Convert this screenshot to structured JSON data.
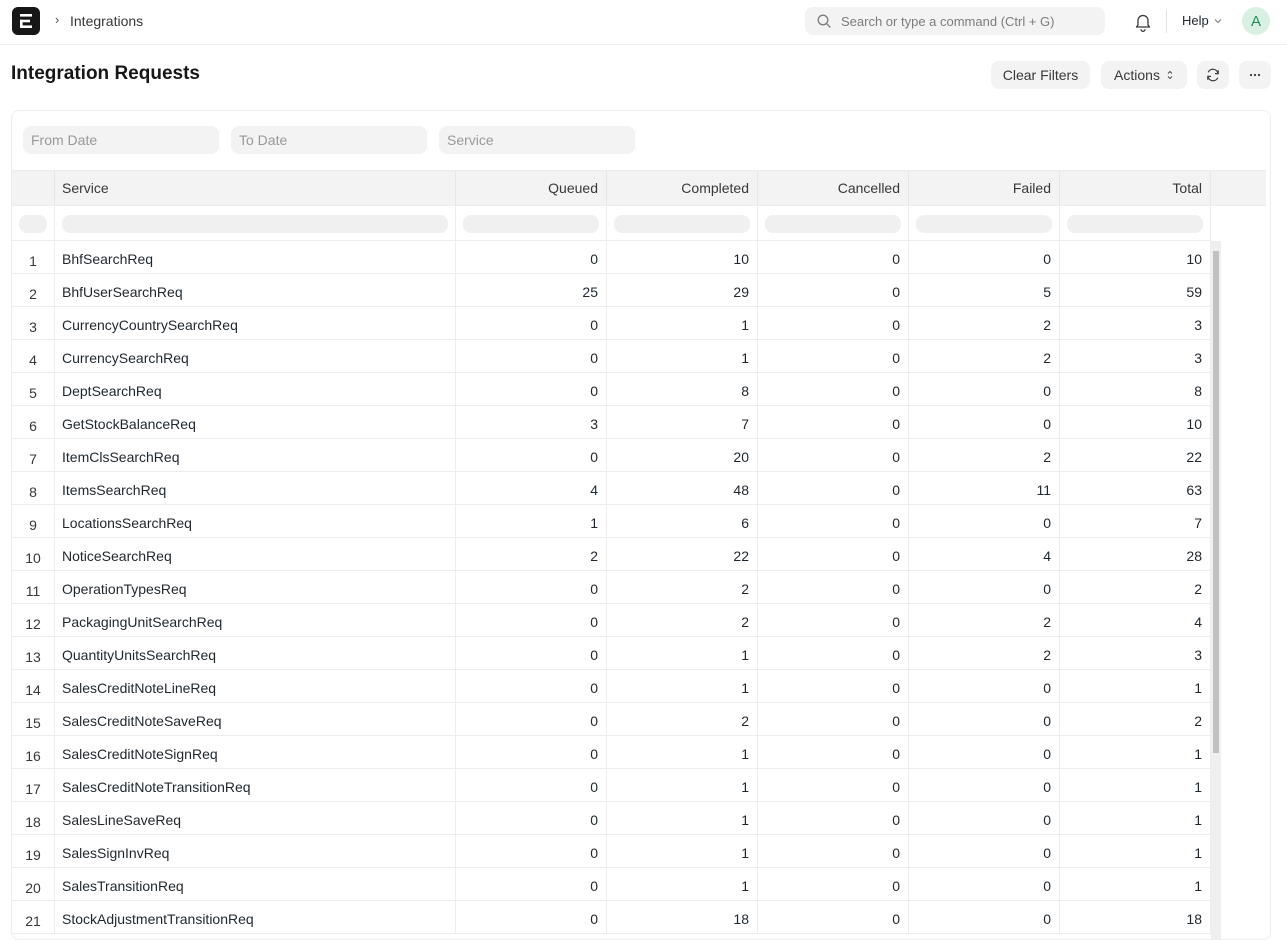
{
  "navbar": {
    "logo_letter": "E",
    "breadcrumb": "Integrations",
    "search_placeholder": "Search or type a command (Ctrl + G)",
    "help_label": "Help",
    "avatar_initial": "A"
  },
  "page": {
    "title": "Integration Requests",
    "clear_filters_label": "Clear Filters",
    "actions_label": "Actions"
  },
  "filters": {
    "from_date_placeholder": "From Date",
    "to_date_placeholder": "To Date",
    "service_placeholder": "Service"
  },
  "table": {
    "columns": [
      "Service",
      "Queued",
      "Completed",
      "Cancelled",
      "Failed",
      "Total"
    ],
    "rows": [
      {
        "idx": "1",
        "service": "BhfSearchReq",
        "queued": "0",
        "completed": "10",
        "cancelled": "0",
        "failed": "0",
        "total": "10"
      },
      {
        "idx": "2",
        "service": "BhfUserSearchReq",
        "queued": "25",
        "completed": "29",
        "cancelled": "0",
        "failed": "5",
        "total": "59"
      },
      {
        "idx": "3",
        "service": "CurrencyCountrySearchReq",
        "queued": "0",
        "completed": "1",
        "cancelled": "0",
        "failed": "2",
        "total": "3"
      },
      {
        "idx": "4",
        "service": "CurrencySearchReq",
        "queued": "0",
        "completed": "1",
        "cancelled": "0",
        "failed": "2",
        "total": "3"
      },
      {
        "idx": "5",
        "service": "DeptSearchReq",
        "queued": "0",
        "completed": "8",
        "cancelled": "0",
        "failed": "0",
        "total": "8"
      },
      {
        "idx": "6",
        "service": "GetStockBalanceReq",
        "queued": "3",
        "completed": "7",
        "cancelled": "0",
        "failed": "0",
        "total": "10"
      },
      {
        "idx": "7",
        "service": "ItemClsSearchReq",
        "queued": "0",
        "completed": "20",
        "cancelled": "0",
        "failed": "2",
        "total": "22"
      },
      {
        "idx": "8",
        "service": "ItemsSearchReq",
        "queued": "4",
        "completed": "48",
        "cancelled": "0",
        "failed": "11",
        "total": "63"
      },
      {
        "idx": "9",
        "service": "LocationsSearchReq",
        "queued": "1",
        "completed": "6",
        "cancelled": "0",
        "failed": "0",
        "total": "7"
      },
      {
        "idx": "10",
        "service": "NoticeSearchReq",
        "queued": "2",
        "completed": "22",
        "cancelled": "0",
        "failed": "4",
        "total": "28"
      },
      {
        "idx": "11",
        "service": "OperationTypesReq",
        "queued": "0",
        "completed": "2",
        "cancelled": "0",
        "failed": "0",
        "total": "2"
      },
      {
        "idx": "12",
        "service": "PackagingUnitSearchReq",
        "queued": "0",
        "completed": "2",
        "cancelled": "0",
        "failed": "2",
        "total": "4"
      },
      {
        "idx": "13",
        "service": "QuantityUnitsSearchReq",
        "queued": "0",
        "completed": "1",
        "cancelled": "0",
        "failed": "2",
        "total": "3"
      },
      {
        "idx": "14",
        "service": "SalesCreditNoteLineReq",
        "queued": "0",
        "completed": "1",
        "cancelled": "0",
        "failed": "0",
        "total": "1"
      },
      {
        "idx": "15",
        "service": "SalesCreditNoteSaveReq",
        "queued": "0",
        "completed": "2",
        "cancelled": "0",
        "failed": "0",
        "total": "2"
      },
      {
        "idx": "16",
        "service": "SalesCreditNoteSignReq",
        "queued": "0",
        "completed": "1",
        "cancelled": "0",
        "failed": "0",
        "total": "1"
      },
      {
        "idx": "17",
        "service": "SalesCreditNoteTransitionReq",
        "queued": "0",
        "completed": "1",
        "cancelled": "0",
        "failed": "0",
        "total": "1"
      },
      {
        "idx": "18",
        "service": "SalesLineSaveReq",
        "queued": "0",
        "completed": "1",
        "cancelled": "0",
        "failed": "0",
        "total": "1"
      },
      {
        "idx": "19",
        "service": "SalesSignInvReq",
        "queued": "0",
        "completed": "1",
        "cancelled": "0",
        "failed": "0",
        "total": "1"
      },
      {
        "idx": "20",
        "service": "SalesTransitionReq",
        "queued": "0",
        "completed": "1",
        "cancelled": "0",
        "failed": "0",
        "total": "1"
      },
      {
        "idx": "21",
        "service": "StockAdjustmentTransitionReq",
        "queued": "0",
        "completed": "18",
        "cancelled": "0",
        "failed": "0",
        "total": "18"
      }
    ]
  }
}
